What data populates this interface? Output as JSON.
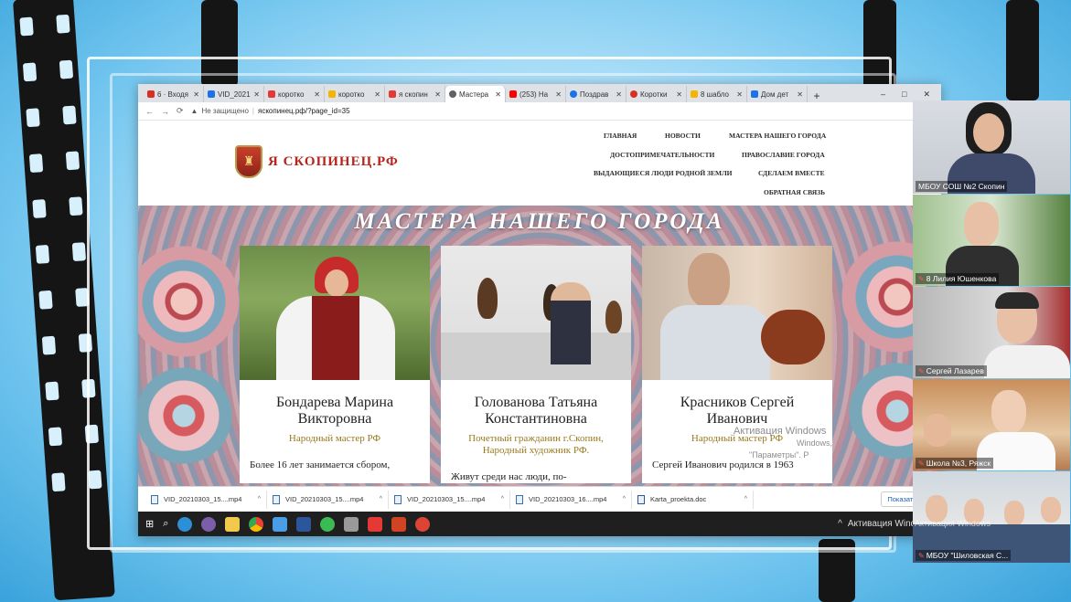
{
  "browser": {
    "tabs": [
      {
        "label": "6 · Входя",
        "color": "#d93025"
      },
      {
        "label": "VID_2021",
        "color": "#1a73e8"
      },
      {
        "label": "коротко",
        "color": "#e53935"
      },
      {
        "label": "коротко",
        "color": "#f4b400"
      },
      {
        "label": "я скопин",
        "color": "#e53935"
      },
      {
        "label": "Мастера",
        "color": "#5f6368"
      },
      {
        "label": "(253) Нa",
        "color": "#ff0000"
      },
      {
        "label": "Поздрав",
        "color": "#1a73e8"
      },
      {
        "label": "Коротки",
        "color": "#d93025"
      },
      {
        "label": "8 шабло",
        "color": "#f4b400"
      },
      {
        "label": "Дом дет",
        "color": "#1a73e8"
      }
    ],
    "new_tab": "+",
    "window_controls": [
      "–",
      "□",
      "✕"
    ],
    "address": {
      "security": "Не защищено",
      "url": "яскопинец.рф/?page_id=35"
    },
    "nav_icons": [
      "←",
      "→",
      "⟳"
    ]
  },
  "site": {
    "logo_text": "Я СКОПИНЕЦ.РФ",
    "menu": [
      "ГЛАВНАЯ",
      "НОВОСТИ",
      "МАСТЕРА НАШЕГО ГОРОДА",
      "ДОСТОПРИМЕЧАТЕЛЬНОСТИ",
      "ПРАВОСЛАВИЕ ГОРОДА",
      "ВЫДАЮЩИЕСЯ ЛЮДИ РОДНОЙ ЗЕМЛИ",
      "СДЕЛАЕМ ВМЕСТЕ",
      "ОБРАТНАЯ СВЯЗЬ"
    ],
    "hero_title": "МАСТЕРА НАШЕГО ГОРОДА",
    "cards": [
      {
        "name": "Бондарева Марина Викторовна",
        "role": "Народный мастер РФ",
        "desc": "Более 16 лет занимается сбором,"
      },
      {
        "name": "Голованова Татьяна Константиновна",
        "role": "Почетный гражданин г.Скопин, Народный художник РФ.",
        "desc": "Живут среди нас люди, по-"
      },
      {
        "name": "Красников Сергей Иванович",
        "role": "Народный мастер РФ",
        "desc": "Сергей Иванович родился в 1963"
      }
    ],
    "watermark_line1": "Активация Windows",
    "watermark_line2": "Windows,",
    "watermark_line3": "\"Параметры\". Р"
  },
  "downloads": {
    "items": [
      "VID_20210303_15....mp4",
      "VID_20210303_15....mp4",
      "VID_20210303_15....mp4",
      "VID_20210303_16....mp4",
      "Karta_proekta.doc"
    ],
    "show_all": "Показать вс"
  },
  "taskbar": {
    "tray_text": "Активация Windows",
    "icons": [
      "start",
      "search",
      "edge",
      "tor",
      "explorer",
      "chrome",
      "mail",
      "word",
      "excel-green",
      "photos",
      "yandex",
      "powerpoint",
      "chrome-red"
    ],
    "icon_colors": [
      "#ffffff",
      "#ffffff",
      "#2d8fd5",
      "#7b5ea7",
      "#f2c94c",
      "#ea4335",
      "#4a9ee8",
      "#2b579a",
      "#3cba54",
      "#9a9a9a",
      "#e53935",
      "#d04423",
      "#db4437"
    ]
  },
  "video": {
    "participants": [
      {
        "name": "МБОУ СОШ №2 Скопин",
        "muted": false
      },
      {
        "name": "8 Лилия Юшенкова",
        "muted": true
      },
      {
        "name": "Сергей Лазарев",
        "muted": true
      },
      {
        "name": "Школа №3, Ряжск",
        "muted": true
      },
      {
        "name": "МБОУ \"Шиловская С...",
        "muted": true
      }
    ],
    "overlay_text": "Активация Windows"
  }
}
